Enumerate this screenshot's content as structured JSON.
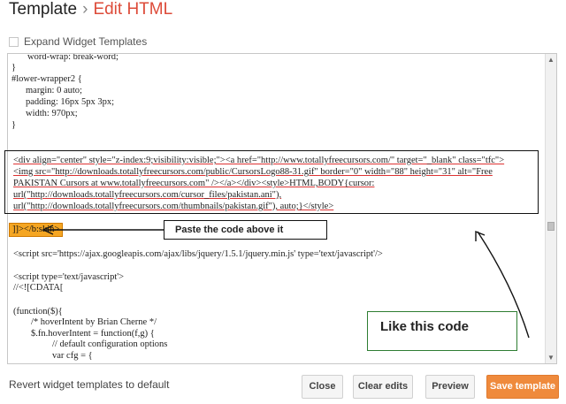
{
  "header": {
    "crumb": "Template",
    "separator": "›",
    "title": "Edit HTML"
  },
  "expand": {
    "label": "Expand Widget Templates"
  },
  "editor": {
    "lines": [
      "word-wrap: break-word;",
      "}",
      "#lower-wrapper2 {",
      "margin: 0 auto;",
      "padding: 16px 5px 3px;",
      "width: 970px;",
      "}",
      "<div align=\"center\" style=\"z-index:9;visibility:visible;\"><a href=\"http://www.totallyfreecursors.com/\" target=\"_blank\" class=\"tfc\">",
      "<img src=\"http://downloads.totallyfreecursors.com/public/CursorsLogo88-31.gif\" border=\"0\" width=\"88\" height=\"31\" alt=\"Free",
      "PAKISTAN Cursors at www.totallyfreecursors.com\" /></a></div><style>HTML,BODY{cursor:",
      "url(\"http://downloads.totallyfreecursors.com/cursor_files/pakistan.ani\"),",
      "url(\"http://downloads.totallyfreecursors.com/thumbnails/pakistan.gif\"), auto;}</style>",
      "<script src='https://ajax.googleapis.com/ajax/libs/jquery/1.5.1/jquery.min.js' type='text/javascript'/>",
      "<script type='text/javascript'>",
      "//<![CDATA[",
      "(function($){",
      "/* hoverIntent by Brian Cherne */",
      "$.fn.hoverIntent = function(f,g) {",
      "// default configuration options",
      "var cfg = {"
    ],
    "skin_tag": "]]></b:skin>"
  },
  "annotations": {
    "paste_label": "Paste the code above it",
    "like_label": "Like this code"
  },
  "footer": {
    "revert_link": "Revert widget templates to default",
    "close": "Close",
    "clear_edits": "Clear edits",
    "preview": "Preview",
    "save": "Save template"
  },
  "colors": {
    "accent": "#dd4b39",
    "save_button": "#ef8a3c",
    "skin_highlight": "#f5a623",
    "callout_border": "#2e7d32"
  }
}
